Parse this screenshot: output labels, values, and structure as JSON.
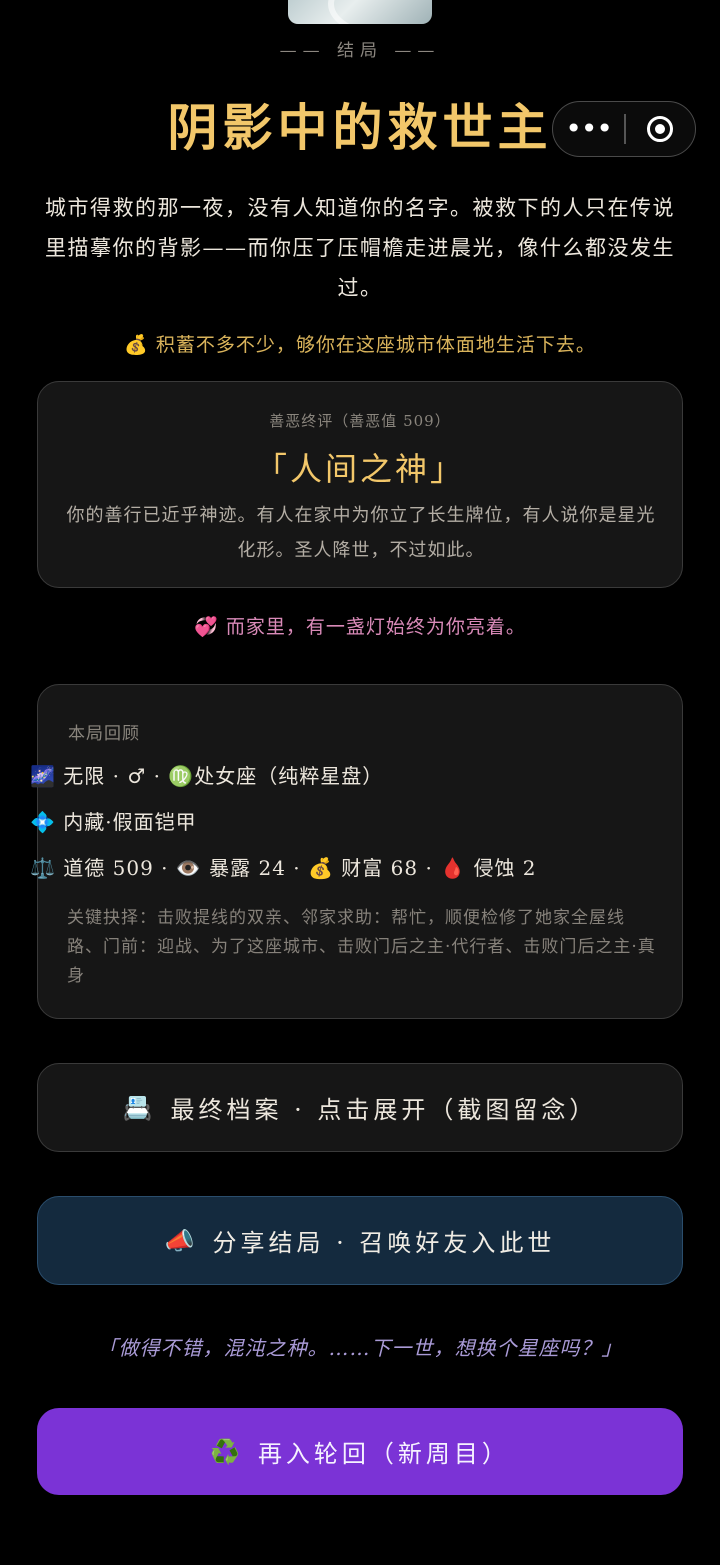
{
  "header": {
    "eyebrow": "—— 结局 ——",
    "title": "阴影中的救世主",
    "capsule_more": "•••"
  },
  "story": {
    "text": "城市得救的那一夜，没有人知道你的名字。被救下的人只在传说里描摹你的背影——而你压了压帽檐走进晨光，像什么都没发生过。",
    "savings_icon": "💰",
    "savings": "积蓄不多不少，够你在这座城市体面地生活下去。"
  },
  "verdict": {
    "label": "善恶终评（善恶值 509）",
    "title": "「人间之神」",
    "desc": "你的善行已近乎神迹。有人在家中为你立了长生牌位，有人说你是星光化形。圣人降世，不过如此。"
  },
  "family": {
    "icon": "💞",
    "text": "而家里，有一盏灯始终为你亮着。"
  },
  "review": {
    "label": "本局回顾",
    "line1_icon": "🌌",
    "line1": "无限 · ♂ · ♍处女座（纯粹星盘）",
    "line2_icon": "💠",
    "line2": "内藏·假面铠甲",
    "stats": {
      "morality_icon": "⚖️",
      "morality": "道德 509",
      "exposure_icon": "👁️",
      "exposure": "暴露 24",
      "wealth_icon": "💰",
      "wealth": "财富 68",
      "erosion_icon": "🩸",
      "erosion": "侵蚀 2",
      "sep": " · "
    },
    "key_choices": "关键抉择：击败提线的双亲、邻家求助：帮忙，顺便检修了她家全屋线路、门前：迎战、为了这座城市、击败门后之主·代行者、击败门后之主·真身"
  },
  "buttons": {
    "archive_icon": "📇",
    "archive": "最终档案 · 点击展开（截图留念）",
    "share_icon": "📣",
    "share": "分享结局 · 召唤好友入此世",
    "rebirth_icon": "♻️",
    "rebirth": "再入轮回（新周目）"
  },
  "quote": "「做得不错，混沌之种。……下一世，想换个星座吗？」",
  "colors": {
    "background": "#000000",
    "gold": "#f2c76a",
    "pink": "#d98ab8",
    "quote": "#a99ad6",
    "share_bg": "#142a3e",
    "rebirth_bg": "#7b33d6"
  }
}
